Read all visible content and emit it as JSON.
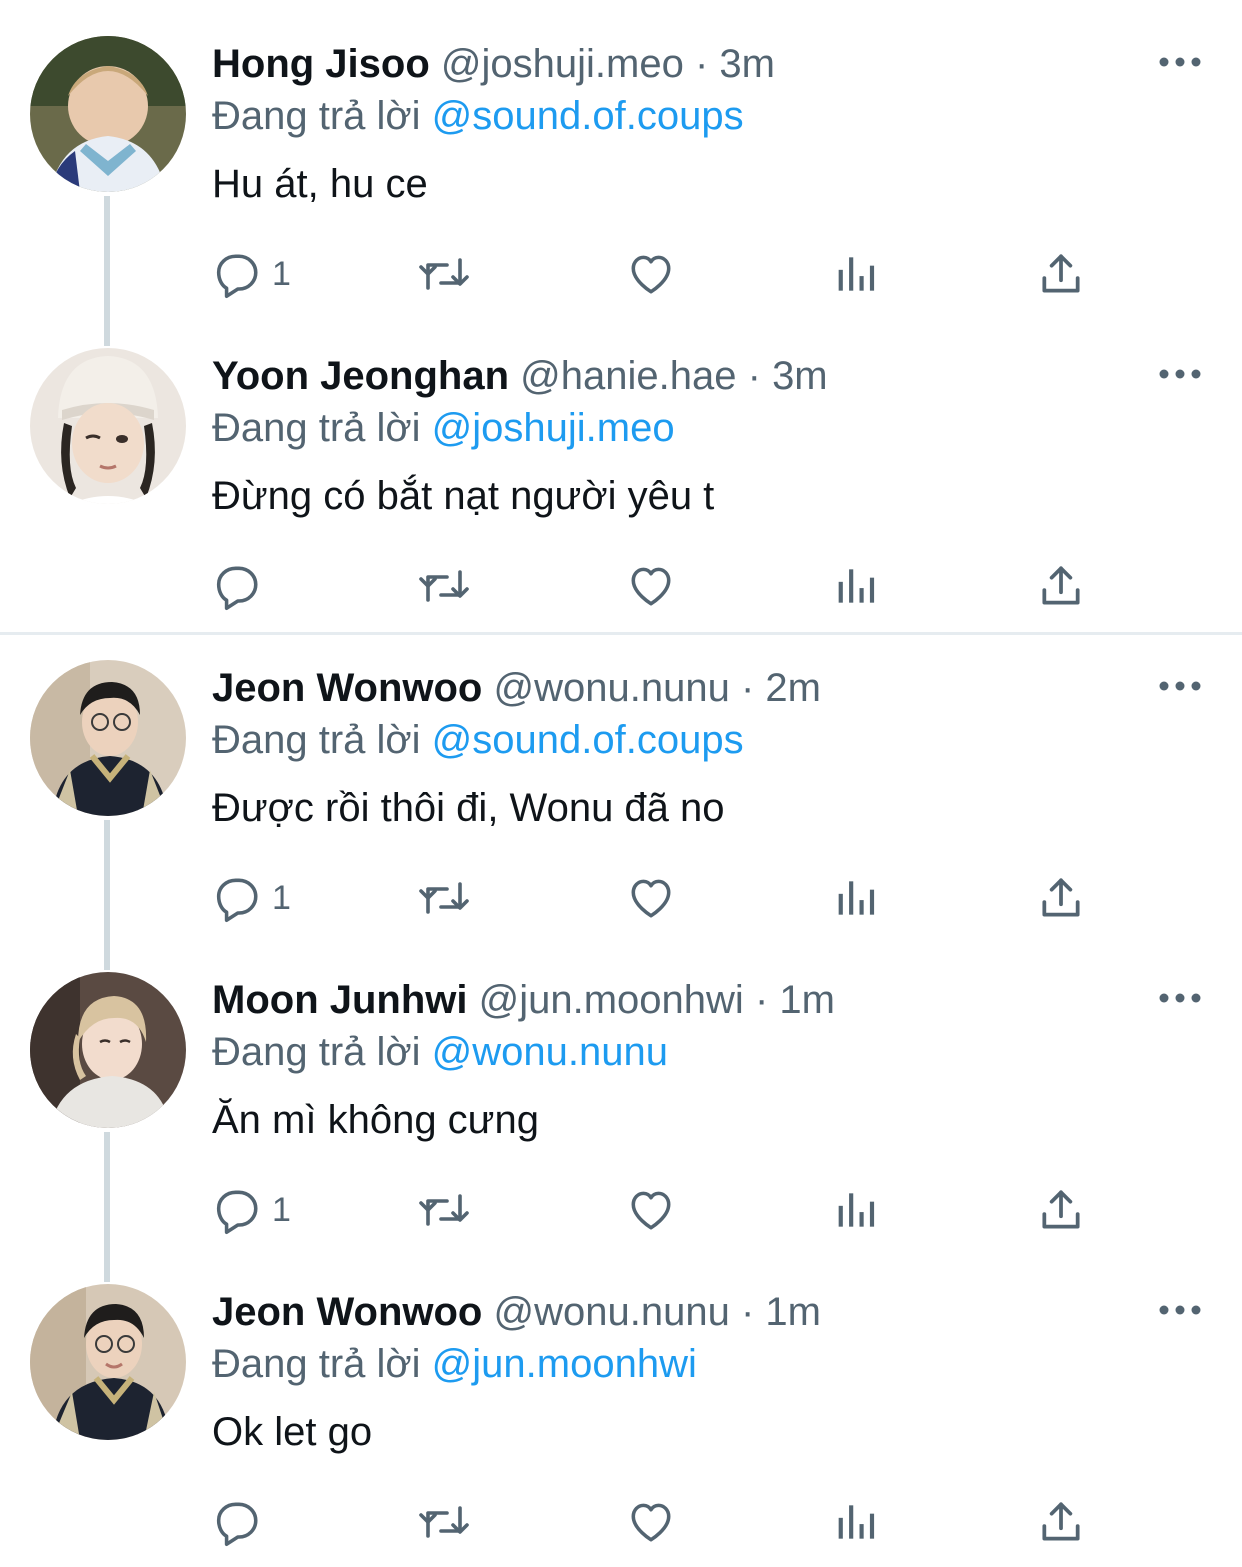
{
  "colors": {
    "text": "#0f1419",
    "secondary": "#536471",
    "link": "#1d9bf0",
    "thread_line": "#cfd9de",
    "divider": "#e6ecf0"
  },
  "tweets": [
    {
      "name": "Hong Jisoo",
      "handle": "@joshuji.meo",
      "separator": "·",
      "time": "3m",
      "replying_label": "Đang trả lời",
      "replying_to": "@sound.of.coups",
      "text": "Hu át, hu ce",
      "reply_count": "1",
      "avatar_icon": "avatar-photo"
    },
    {
      "name": "Yoon Jeonghan",
      "handle": "@hanie.hae",
      "separator": "·",
      "time": "3m",
      "replying_label": "Đang trả lời",
      "replying_to": "@joshuji.meo",
      "text": "Đừng có bắt nạt người yêu t",
      "reply_count": "",
      "avatar_icon": "avatar-photo"
    },
    {
      "name": "Jeon Wonwoo",
      "handle": "@wonu.nunu",
      "separator": "·",
      "time": "2m",
      "replying_label": "Đang trả lời",
      "replying_to": "@sound.of.coups",
      "text": "Được rồi thôi đi, Wonu đã no",
      "reply_count": "1",
      "avatar_icon": "avatar-photo"
    },
    {
      "name": "Moon Junhwi",
      "handle": "@jun.moonhwi",
      "separator": "·",
      "time": "1m",
      "replying_label": "Đang trả lời",
      "replying_to": "@wonu.nunu",
      "text": "Ăn mì không cưng",
      "reply_count": "1",
      "avatar_icon": "avatar-photo"
    },
    {
      "name": "Jeon Wonwoo",
      "handle": "@wonu.nunu",
      "separator": "·",
      "time": "1m",
      "replying_label": "Đang trả lời",
      "replying_to": "@jun.moonhwi",
      "text": "Ok let go",
      "reply_count": "",
      "avatar_icon": "avatar-photo"
    }
  ],
  "icons": {
    "more": "more-horizontal-icon",
    "reply": "reply-icon",
    "retweet": "retweet-icon",
    "like": "heart-icon",
    "views": "views-bar-chart-icon",
    "share": "share-icon"
  }
}
